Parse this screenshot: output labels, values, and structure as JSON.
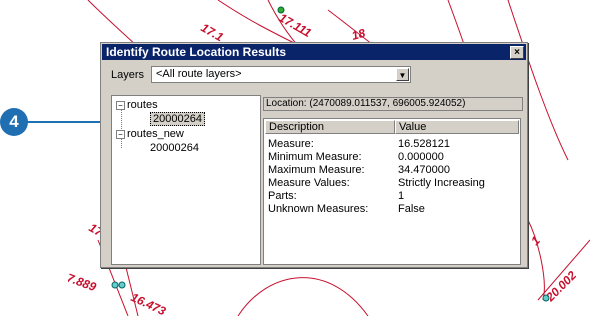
{
  "map": {
    "labels": [
      "17.1",
      "17.111",
      "18",
      "17.",
      "7.889",
      "16.473",
      "20.002",
      "1"
    ]
  },
  "callout": {
    "number": "4"
  },
  "dialog": {
    "title": "Identify Route Location Results",
    "close_glyph": "×",
    "layers_label": "Layers",
    "layers_value": "<All route layers>",
    "tree": [
      {
        "label": "routes",
        "child": "20000264"
      },
      {
        "label": "routes_new",
        "child": "20000264"
      }
    ],
    "location": "Location: (2470089.011537, 696005.924052)",
    "columns": {
      "description": "Description",
      "value": "Value"
    },
    "rows": [
      {
        "description": "Measure:",
        "value": "16.528121"
      },
      {
        "description": "Minimum Measure:",
        "value": "0.000000"
      },
      {
        "description": "Maximum Measure:",
        "value": "34.470000"
      },
      {
        "description": "Measure Values:",
        "value": "Strictly Increasing"
      },
      {
        "description": "Parts:",
        "value": "1"
      },
      {
        "description": "Unknown Measures:",
        "value": "False"
      }
    ]
  }
}
